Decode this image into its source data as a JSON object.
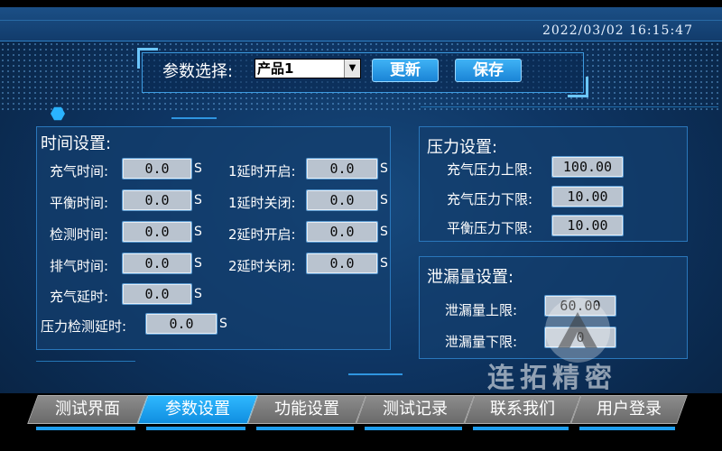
{
  "header": {
    "datetime": "2022/03/02 16:15:47"
  },
  "selector": {
    "label": "参数选择:",
    "selected": "产品1",
    "update_label": "更新",
    "save_label": "保存"
  },
  "time_settings": {
    "title": "时间设置:",
    "unit": "S",
    "fields": [
      {
        "label": "充气时间:",
        "value": "0.0"
      },
      {
        "label": "平衡时间:",
        "value": "0.0"
      },
      {
        "label": "检测时间:",
        "value": "0.0"
      },
      {
        "label": "排气时间:",
        "value": "0.0"
      },
      {
        "label": "充气延时:",
        "value": "0.0"
      },
      {
        "label": "压力检测延时:",
        "value": "0.0"
      },
      {
        "label": "1延时开启:",
        "value": "0.0"
      },
      {
        "label": "1延时关闭:",
        "value": "0.0"
      },
      {
        "label": "2延时开启:",
        "value": "0.0"
      },
      {
        "label": "2延时关闭:",
        "value": "0.0"
      }
    ]
  },
  "pressure_settings": {
    "title": "压力设置:",
    "fields": [
      {
        "label": "充气压力上限:",
        "value": "100.00"
      },
      {
        "label": "充气压力下限:",
        "value": "10.00"
      },
      {
        "label": "平衡压力下限:",
        "value": "10.00"
      }
    ]
  },
  "leak_settings": {
    "title": "泄漏量设置:",
    "fields": [
      {
        "label": "泄漏量上限:",
        "value": "60.00"
      },
      {
        "label": "泄漏量下限:",
        "value": "0"
      }
    ]
  },
  "tabs": [
    {
      "label": "测试界面"
    },
    {
      "label": "参数设置"
    },
    {
      "label": "功能设置"
    },
    {
      "label": "测试记录"
    },
    {
      "label": "联系我们"
    },
    {
      "label": "用户登录"
    }
  ],
  "watermark": "连拓精密",
  "colors": {
    "accent": "#1f9ff0",
    "field_bg": "#b9c3cf",
    "tab_inactive": "#7a7a7a"
  }
}
